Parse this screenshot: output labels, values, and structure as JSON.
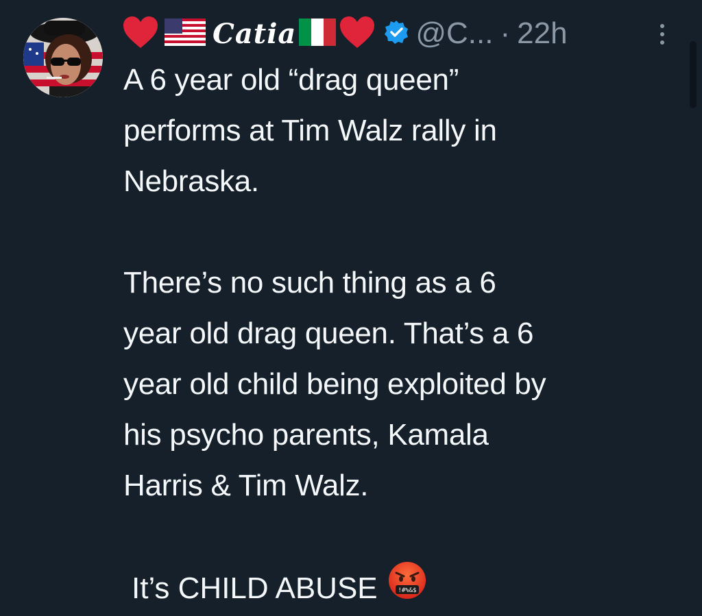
{
  "tweet": {
    "author": {
      "display_name": "Catia",
      "handle": "@C...",
      "time_separator": "·",
      "time": "22h",
      "avatar": "avatar-photo",
      "name_prefix_icons": [
        "red-heart-icon",
        "us-flag-icon"
      ],
      "name_suffix_icons": [
        "italy-flag-icon",
        "red-heart-icon"
      ],
      "verified_icon": "verified-badge-icon",
      "verified_color": "#1d9bf0"
    },
    "more_icon": "more-options-icon",
    "paragraph1": {
      "lines": [
        "A 6 year old “drag queen”",
        "performs at Tim Walz rally in",
        "Nebraska."
      ]
    },
    "paragraph2": {
      "lines": [
        "There’s no such thing as a 6",
        "year old drag queen. That’s a 6",
        "year old child being exploited by",
        "his psycho parents, Kamala",
        "Harris & Tim Walz."
      ]
    },
    "paragraph3": {
      "text": "It’s CHILD ABUSE",
      "emoji": "face-with-symbols-on-mouth-icon"
    }
  },
  "colors": {
    "background": "#15202b",
    "text": "#f5f8fa",
    "secondary_text": "#8b98a5",
    "heart_red": "#e0243a"
  }
}
